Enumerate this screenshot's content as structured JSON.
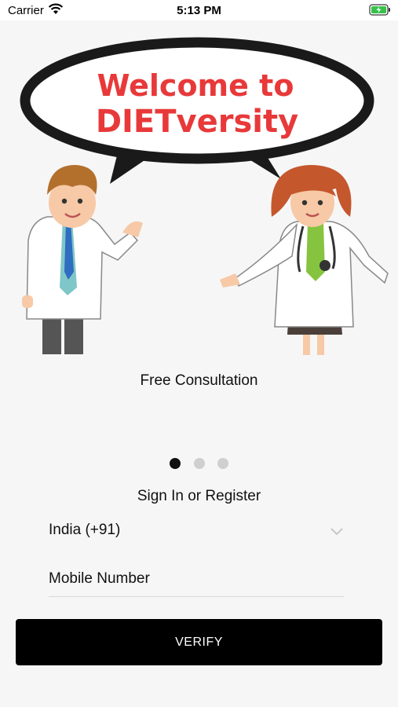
{
  "status_bar": {
    "carrier": "Carrier",
    "time": "5:13 PM"
  },
  "hero": {
    "bubble_line1": "Welcome to",
    "bubble_line2": "DIETversity"
  },
  "carousel": {
    "caption": "Free Consultation",
    "page_count": 3,
    "active_index": 0
  },
  "form": {
    "heading": "Sign In or Register",
    "country_value": "India (+91)",
    "mobile_placeholder": "Mobile Number",
    "verify_label": "VERIFY"
  },
  "colors": {
    "brand_red": "#e8393a",
    "button_bg": "#000000",
    "active_dot": "#111111",
    "inactive_dot": "#cfcfcf"
  }
}
